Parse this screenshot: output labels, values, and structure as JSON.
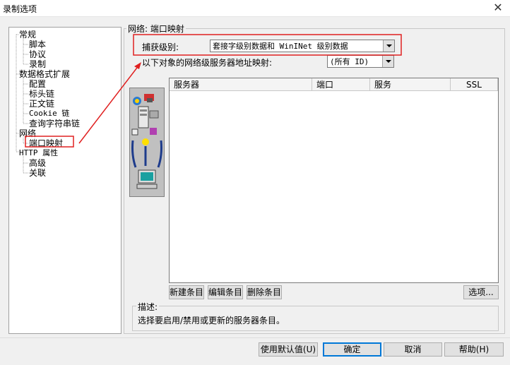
{
  "window": {
    "title": "录制选项"
  },
  "tree": {
    "items": [
      {
        "label": "常规",
        "level": 0
      },
      {
        "label": "脚本",
        "level": 1
      },
      {
        "label": "协议",
        "level": 1
      },
      {
        "label": "录制",
        "level": 1
      },
      {
        "label": "数据格式扩展",
        "level": 0
      },
      {
        "label": "配置",
        "level": 1
      },
      {
        "label": "标头链",
        "level": 1
      },
      {
        "label": "正文链",
        "level": 1
      },
      {
        "label": "Cookie 链",
        "level": 1
      },
      {
        "label": "查询字符串链",
        "level": 1
      },
      {
        "label": "网络",
        "level": 0
      },
      {
        "label": "端口映射",
        "level": 1,
        "selected": true
      },
      {
        "label": "HTTP 属性",
        "level": 0
      },
      {
        "label": "高级",
        "level": 1
      },
      {
        "label": "关联",
        "level": 1
      }
    ]
  },
  "group": {
    "title": "网络: 端口映射"
  },
  "capture": {
    "label": "捕获级别:",
    "value": "套接字级别数据和 WinINet 级别数据"
  },
  "mapping": {
    "label": "以下对象的网络级服务器地址映射:",
    "value": "(所有 ID)"
  },
  "list": {
    "columns": [
      "服务器",
      "端口",
      "服务",
      "SSL"
    ]
  },
  "entry_buttons": {
    "new": "新建条目",
    "edit": "编辑条目",
    "delete": "删除条目",
    "options": "选项..."
  },
  "description": {
    "title": "描述:",
    "text": "选择要启用/禁用或更新的服务器条目。"
  },
  "footer": {
    "defaults": "使用默认值(U)",
    "ok": "确定",
    "cancel": "取消",
    "help": "帮助(H)"
  },
  "annotation_color": "#e02020"
}
